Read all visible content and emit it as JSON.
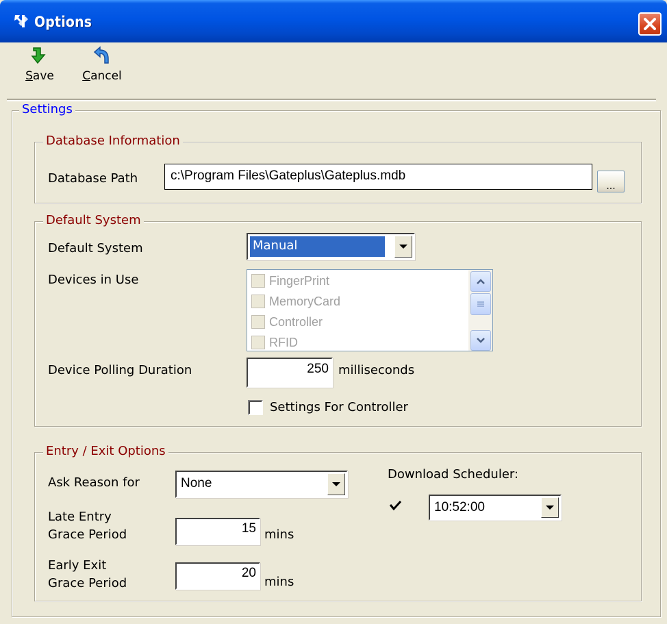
{
  "window": {
    "title": "Options"
  },
  "toolbar": {
    "save": {
      "label": "Save",
      "mnemonic": "S",
      "rest": "ave",
      "icon": "green-down-arrow-icon"
    },
    "cancel": {
      "label": "Cancel",
      "mnemonic": "C",
      "rest": "ancel",
      "icon": "blue-return-arrow-icon"
    }
  },
  "settings": {
    "legend": "Settings",
    "database": {
      "legend": "Database Information",
      "path_label": "Database Path",
      "path_value": "c:\\Program Files\\Gateplus\\Gateplus.mdb",
      "browse_label": "..."
    },
    "default_system": {
      "legend": "Default System",
      "system_label": "Default System",
      "system_value": "Manual",
      "devices_label": "Devices in Use",
      "devices": [
        "FingerPrint",
        "MemoryCard",
        "Controller",
        "RFID"
      ],
      "polling_label": "Device Polling Duration",
      "polling_value": "250",
      "polling_unit": "milliseconds",
      "controller_settings_label": "Settings For Controller",
      "controller_settings_checked": false
    },
    "entry_exit": {
      "legend": "Entry / Exit Options",
      "ask_reason_label": "Ask Reason for",
      "ask_reason_value": "None",
      "late_entry_label_1": "Late Entry",
      "late_entry_label_2": "Grace Period",
      "late_entry_value": "15",
      "early_exit_label_1": "Early Exit",
      "early_exit_label_2": "Grace Period",
      "early_exit_value": "20",
      "unit": "mins",
      "scheduler_label": "Download Scheduler:",
      "scheduler_checked": true,
      "scheduler_time": "10:52:00"
    }
  },
  "colors": {
    "titlebar": "#0054e3",
    "legend_settings": "#0000ff",
    "legend_group": "#8b0000",
    "selection": "#316ac5"
  }
}
